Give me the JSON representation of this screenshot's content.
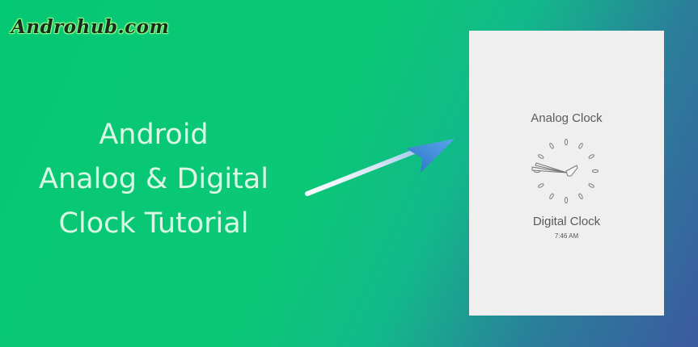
{
  "brand": {
    "text": "Androhub.com"
  },
  "headline": {
    "lines": [
      "Android",
      "Analog & Digital",
      "Clock Tutorial"
    ]
  },
  "phone": {
    "analog_title": "Analog Clock",
    "digital_title": "Digital Clock",
    "digital_time": "7:46 AM"
  },
  "colors": {
    "background_start": "#05c873",
    "background_end": "#3c5aa0",
    "headline": "#d9f7e3",
    "phone_bg": "#efefef",
    "arrow": "#3a86d8"
  },
  "icons": {
    "arrow": "arrow-icon",
    "clock": "analog-clock-icon"
  }
}
